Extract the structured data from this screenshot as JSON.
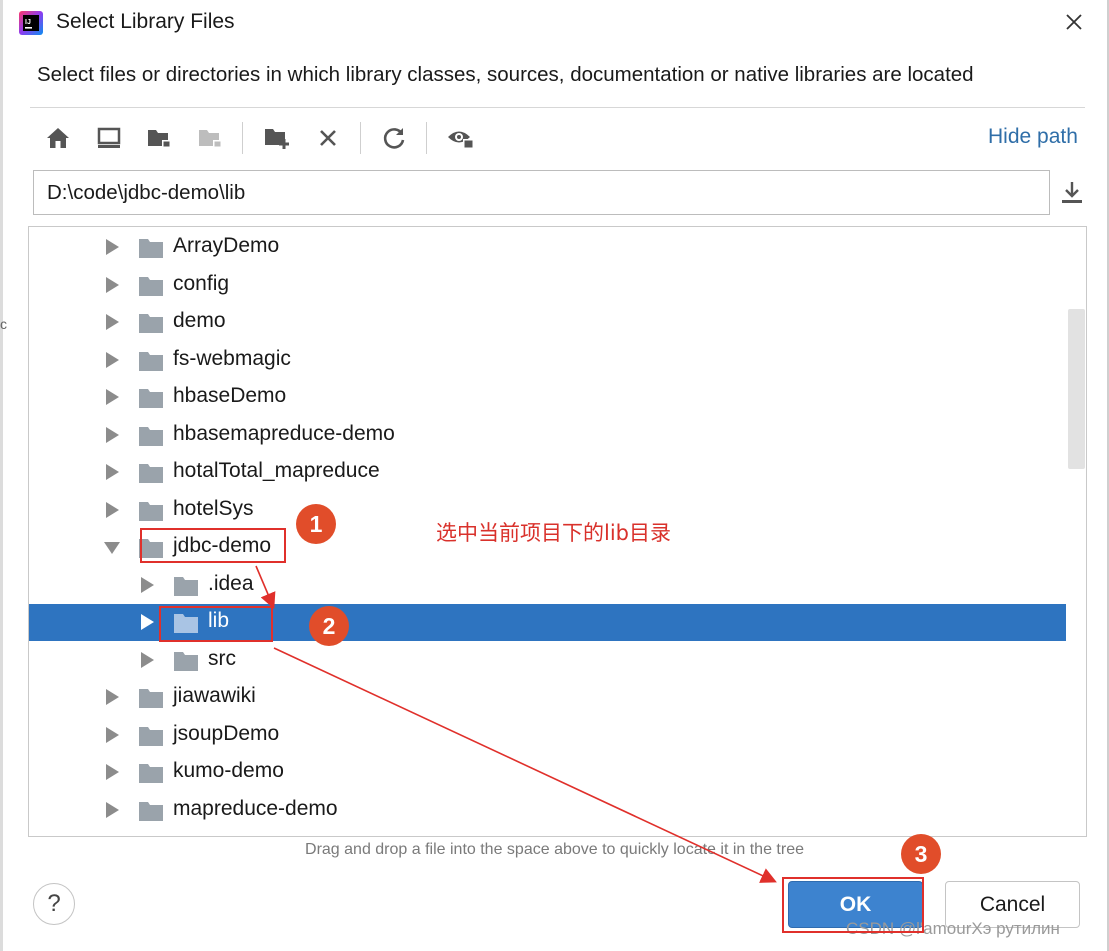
{
  "dialog": {
    "title": "Select Library Files",
    "description": "Select files or directories in which library classes, sources, documentation or native libraries are located"
  },
  "toolbar": {
    "buttons": [
      "home-icon",
      "desktop-icon",
      "project-folder-icon",
      "module-folder-icon",
      "new-folder-icon",
      "delete-icon",
      "refresh-icon",
      "show-hidden-icon"
    ],
    "hide_path_label": "Hide path"
  },
  "path": {
    "value": "D:\\code\\jdbc-demo\\lib"
  },
  "tree": {
    "rows": [
      {
        "label": "ArrayDemo",
        "depth": 0,
        "expanded": false,
        "selected": false
      },
      {
        "label": "config",
        "depth": 0,
        "expanded": false,
        "selected": false
      },
      {
        "label": "demo",
        "depth": 0,
        "expanded": false,
        "selected": false
      },
      {
        "label": "fs-webmagic",
        "depth": 0,
        "expanded": false,
        "selected": false
      },
      {
        "label": "hbaseDemo",
        "depth": 0,
        "expanded": false,
        "selected": false
      },
      {
        "label": "hbasemapreduce-demo",
        "depth": 0,
        "expanded": false,
        "selected": false
      },
      {
        "label": "hotalTotal_mapreduce",
        "depth": 0,
        "expanded": false,
        "selected": false
      },
      {
        "label": "hotelSys",
        "depth": 0,
        "expanded": false,
        "selected": false
      },
      {
        "label": "jdbc-demo",
        "depth": 0,
        "expanded": true,
        "selected": false
      },
      {
        "label": ".idea",
        "depth": 1,
        "expanded": false,
        "selected": false
      },
      {
        "label": "lib",
        "depth": 1,
        "expanded": false,
        "selected": true
      },
      {
        "label": "src",
        "depth": 1,
        "expanded": false,
        "selected": false
      },
      {
        "label": "jiawawiki",
        "depth": 0,
        "expanded": false,
        "selected": false
      },
      {
        "label": "jsoupDemo",
        "depth": 0,
        "expanded": false,
        "selected": false
      },
      {
        "label": "kumo-demo",
        "depth": 0,
        "expanded": false,
        "selected": false
      },
      {
        "label": "mapreduce-demo",
        "depth": 0,
        "expanded": false,
        "selected": false
      }
    ]
  },
  "hint": "Drag and drop a file into the space above to quickly locate it in the tree",
  "buttons": {
    "help": "?",
    "ok": "OK",
    "cancel": "Cancel"
  },
  "annotations": {
    "note": "选中当前项目下的lib目录",
    "badge1": "1",
    "badge2": "2",
    "badge3": "3"
  },
  "watermark": "CSDN @l'amourXэ рутилин",
  "colors": {
    "selection": "#2e74c0",
    "link": "#2f6ea8",
    "ok_button": "#3d83cf",
    "annotation_red": "#e0302b",
    "badge": "#e14d2a",
    "folder": "#9aa3ab"
  }
}
